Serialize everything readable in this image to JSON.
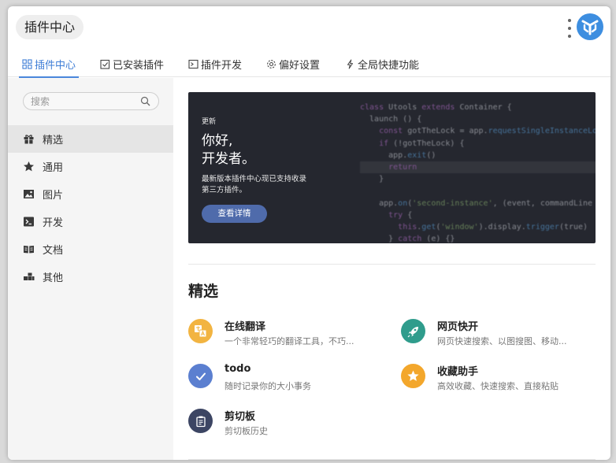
{
  "header": {
    "title": "插件中心"
  },
  "tabs": [
    {
      "label": "插件中心",
      "icon": "grid-icon",
      "active": true
    },
    {
      "label": "已安装插件",
      "icon": "checkbox-icon"
    },
    {
      "label": "插件开发",
      "icon": "terminal-icon"
    },
    {
      "label": "偏好设置",
      "icon": "gear-icon"
    },
    {
      "label": "全局快捷功能",
      "icon": "bolt-icon"
    }
  ],
  "sidebar": {
    "search_placeholder": "搜索",
    "items": [
      {
        "label": "精选",
        "icon": "gift-icon",
        "active": true
      },
      {
        "label": "通用",
        "icon": "star-icon"
      },
      {
        "label": "图片",
        "icon": "image-icon"
      },
      {
        "label": "开发",
        "icon": "terminal-icon"
      },
      {
        "label": "文档",
        "icon": "book-icon"
      },
      {
        "label": "其他",
        "icon": "blocks-icon"
      }
    ]
  },
  "banner": {
    "tag": "更新",
    "title_line1": "你好,",
    "title_line2": "开发者。",
    "desc_line1": "最新版本插件中心现已支持收录",
    "desc_line2": "第三方插件。",
    "button_label": "查看详情",
    "code_lines": [
      "class Utools extends Container {",
      "  launch () {",
      "    const gotTheLock = app.requestSingleInstanceLock()",
      "    if (!gotTheLock) {",
      "      app.exit()",
      "      return",
      "    }",
      "",
      "    app.on('second-instance', (event, commandLine",
      "      try {",
      "        this.get('window').display.trigger(true)",
      "      } catch (e) {}"
    ]
  },
  "featured": {
    "title": "精选",
    "plugins": [
      {
        "name": "在线翻译",
        "desc": "一个非常轻巧的翻译工具，不巧...",
        "icon": "translate-icon",
        "color": "#f2b441"
      },
      {
        "name": "网页快开",
        "desc": "网页快速搜索、以图搜图、移动...",
        "icon": "rocket-icon",
        "color": "#2f9c8c"
      },
      {
        "name": "todo",
        "desc": "随时记录你的大小事务",
        "icon": "check-icon",
        "color": "#5b7fd0"
      },
      {
        "name": "收藏助手",
        "desc": "高效收藏、快速搜索、直接粘贴",
        "icon": "star-icon",
        "color": "#f3a72c"
      },
      {
        "name": "剪切板",
        "desc": "剪切板历史",
        "icon": "clipboard-icon",
        "color": "#3c4563"
      }
    ]
  },
  "colors": {
    "accent": "#3f7ed6",
    "banner_bg": "#25272f",
    "logo": "#3d8ee0"
  }
}
